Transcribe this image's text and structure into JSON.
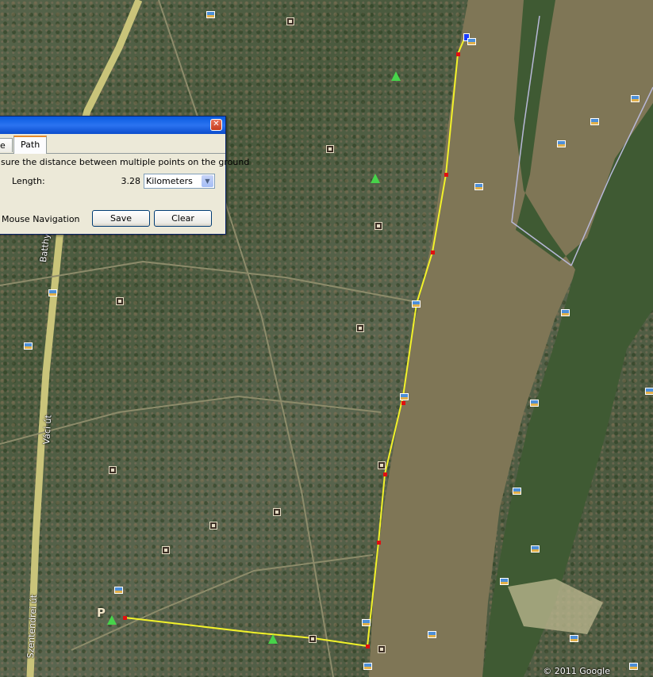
{
  "dialog": {
    "tabs": [
      {
        "label": "e"
      },
      {
        "label": "Path",
        "active": true
      }
    ],
    "description": "sure the distance between multiple points on the ground",
    "length_label": "Length:",
    "length_value": "3.28",
    "unit": "Kilometers",
    "mouse_navigation_label": "Mouse Navigation",
    "save_label": "Save",
    "clear_label": "Clear",
    "close_glyph": "✕"
  },
  "map": {
    "road_labels": {
      "batthyany": "Batthyány",
      "vaci": "Váci út",
      "szentendrei": "Szentendrei út"
    },
    "parking_label": "P",
    "copyright": "© 2011 Google",
    "river_color": "#7f7656",
    "path_color": "#f2f22a",
    "vertex_color": "#e01010"
  }
}
